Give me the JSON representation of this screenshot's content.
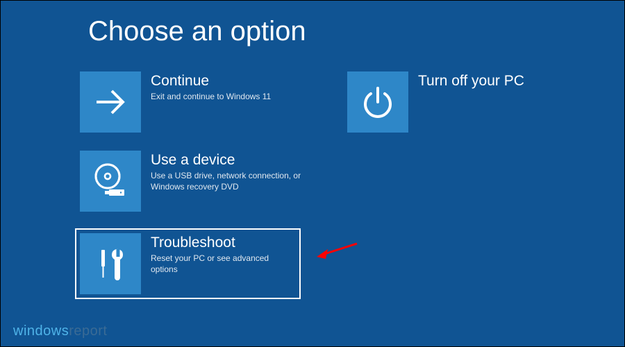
{
  "heading": "Choose an option",
  "tiles": {
    "continue": {
      "title": "Continue",
      "desc": "Exit and continue to Windows 11"
    },
    "turnoff": {
      "title": "Turn off your PC",
      "desc": ""
    },
    "usedevice": {
      "title": "Use a device",
      "desc": "Use a USB drive, network connection, or Windows recovery DVD"
    },
    "troubleshoot": {
      "title": "Troubleshoot",
      "desc": "Reset your PC or see advanced options"
    }
  },
  "watermark": {
    "part1": "windows",
    "part2": "report"
  },
  "colors": {
    "background": "#105493",
    "tile": "#2e87c8",
    "highlight": "#ffffff",
    "arrow": "#ff0000"
  }
}
